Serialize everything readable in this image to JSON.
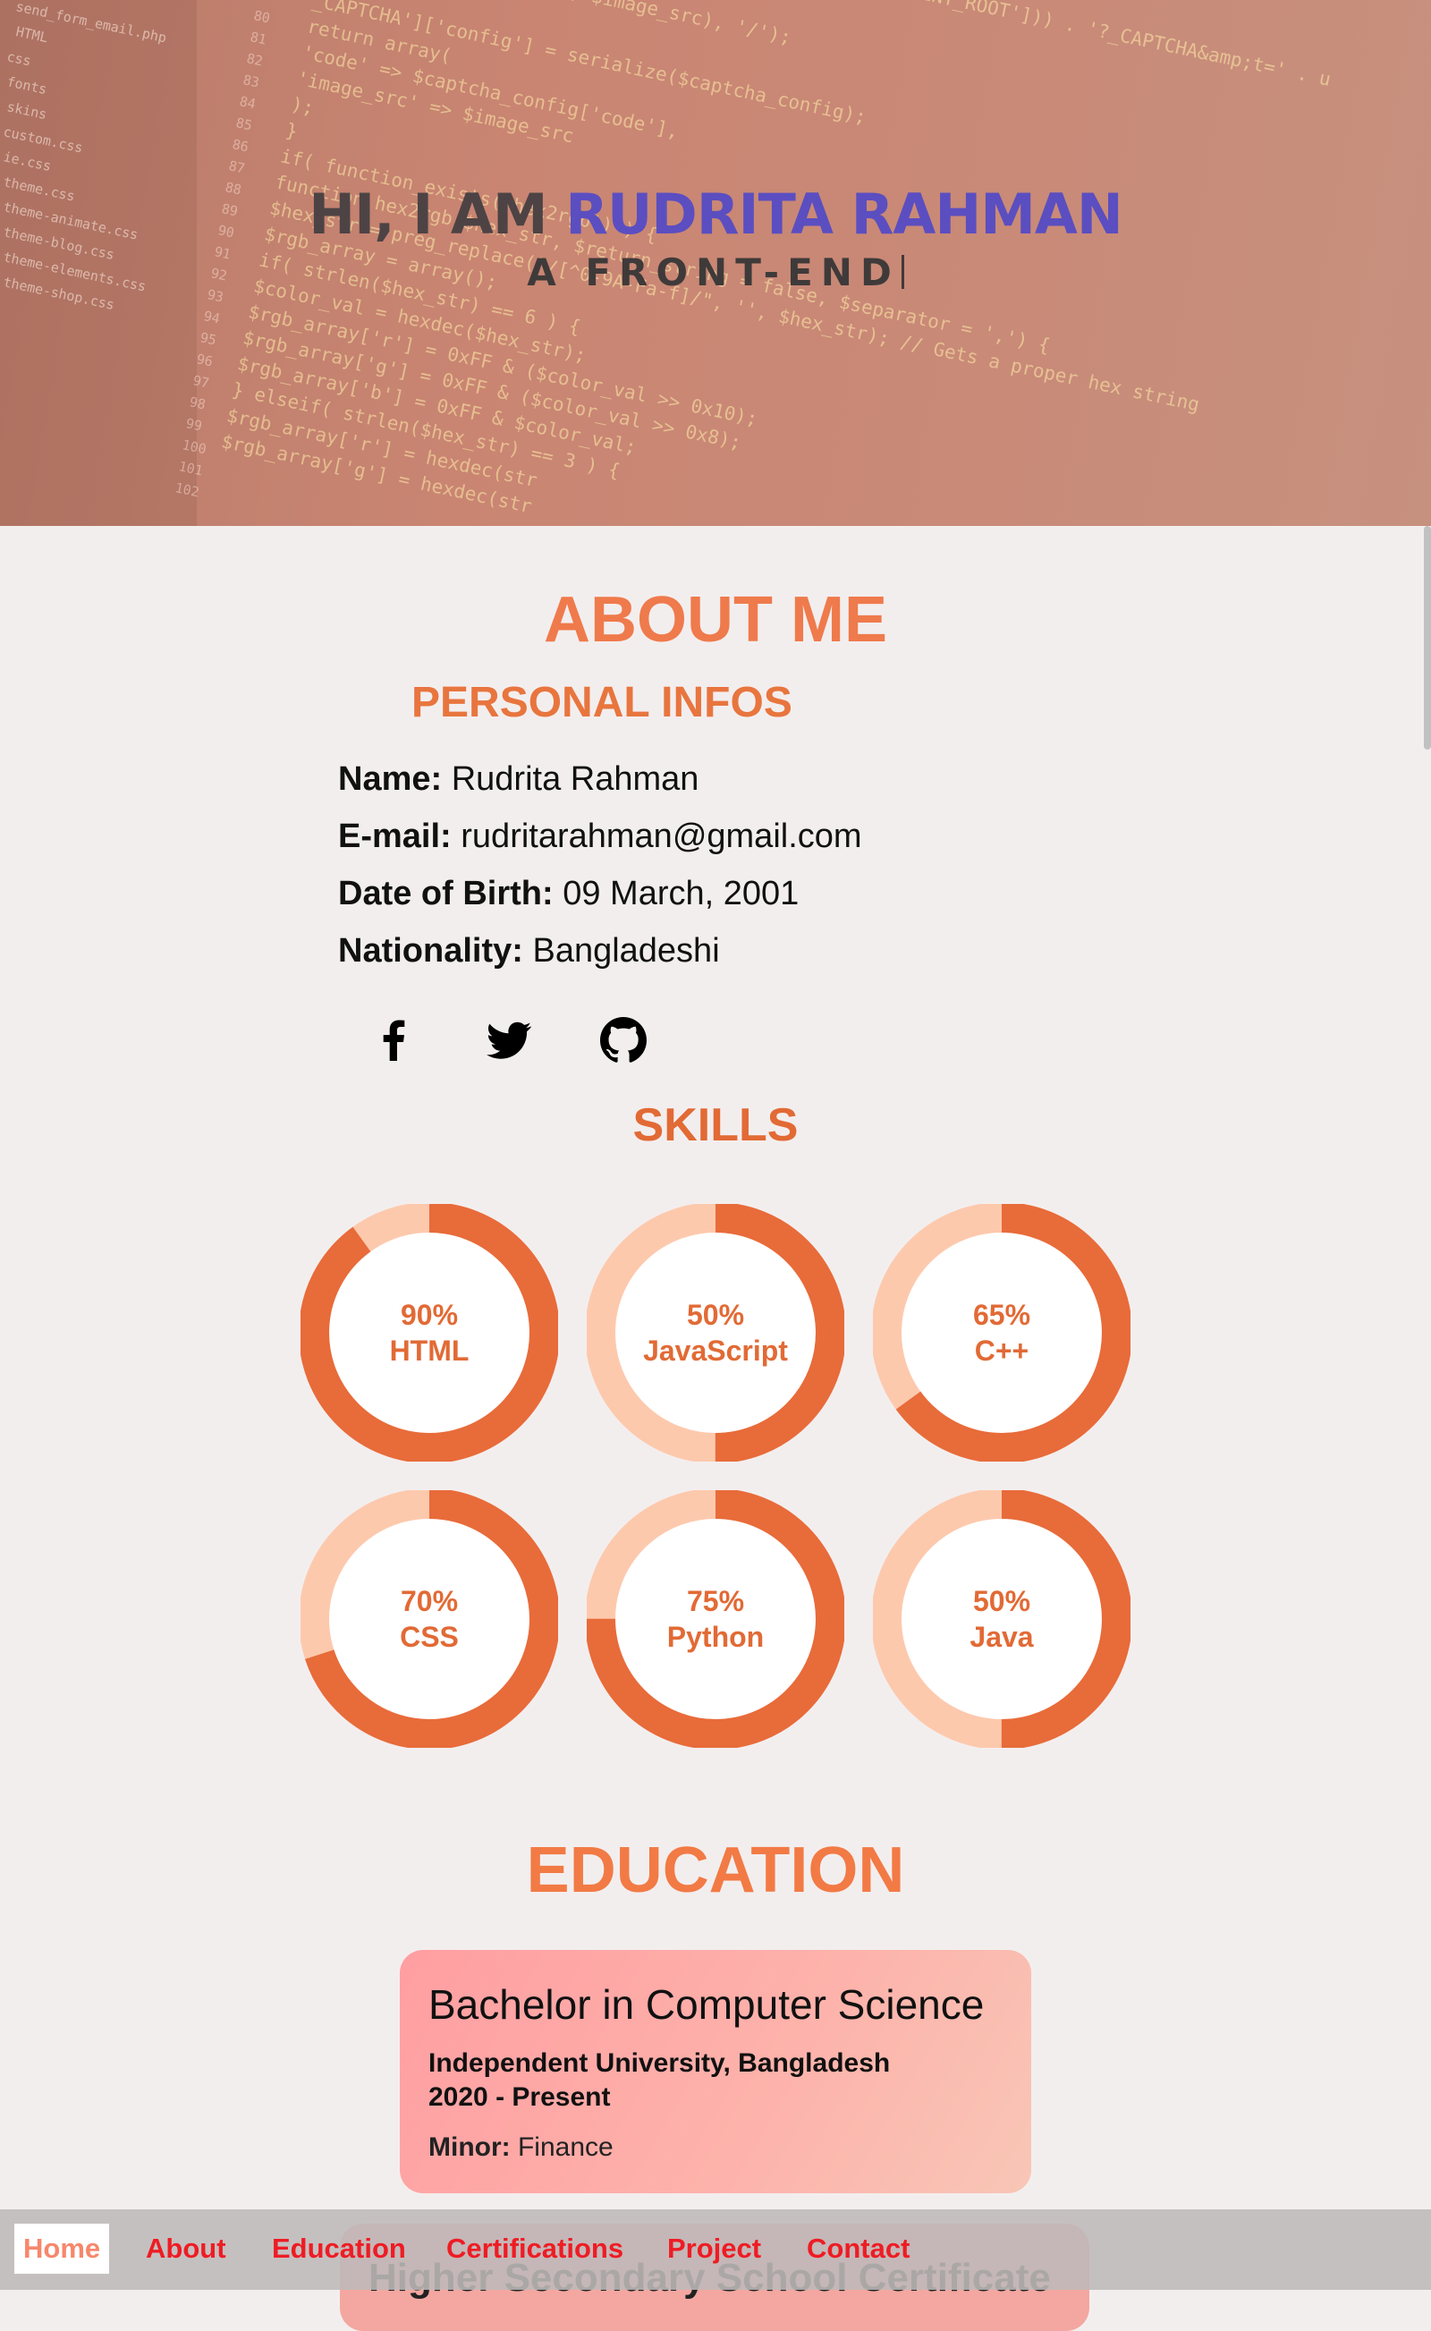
{
  "hero": {
    "greeting": "HI, I AM ",
    "name": "RUDRITA RAHMAN",
    "typed_text": "A FRONT-END",
    "editor_files": [
      "send_form_email.php",
      "HTML",
      "css",
      "fonts",
      "skins",
      "custom.css",
      "ie.css",
      "theme.css",
      "theme-animate.css",
      "theme-blog.css",
      "theme-elements.css",
      "theme-shop.css"
    ],
    "editor_lines": [
      "80",
      "81",
      "82",
      "83",
      "84",
      "85",
      "86",
      "87",
      "88",
      "89",
      "90",
      "91",
      "92",
      "93",
      "94",
      "95",
      "96",
      "97",
      "98",
      "99",
      "100",
      "101",
      "102"
    ],
    "code": [
      "_CAPTCHA']['config'] = serialize($captcha_config);",
      "return array(",
      "  'code' => $captcha_config['code'],",
      "  'image_src' => $image_src",
      ");",
      "}",
      "if( function_exists('hex2rgb') ) {",
      "  function hex2rgb($hex_str, $return_string = false, $separator = ',') {",
      "    $hex_str = preg_replace(\"/[^0-9A-Fa-f]/\", '', $hex_str); // Gets a proper hex string",
      "    $rgb_array = array();",
      "    if( strlen($hex_str) == 6 ) {",
      "      $color_val = hexdec($hex_str);",
      "      $rgb_array['r'] = 0xFF & ($color_val >> 0x10);",
      "      $rgb_array['g'] = 0xFF & ($color_val >> 0x8);",
      "      $rgb_array['b'] = 0xFF & $color_val;",
      "    } elseif( strlen($hex_str) == 3 ) {",
      "      $rgb_array['r'] = hexdec(str",
      "      $rgb_array['g'] = hexdec(str"
    ],
    "code_top_right": "ENT_ROOT'])) . '?_CAPTCHA&amp;t=' . u",
    "code_top_mid": "'/', $image_src), '/');"
  },
  "about": {
    "title": "ABOUT ME",
    "personal_title": "PERSONAL INFOS",
    "fields": [
      {
        "label": "Name:",
        "value": "Rudrita Rahman"
      },
      {
        "label": "E-mail:",
        "value": "rudritarahman@gmail.com"
      },
      {
        "label": "Date of Birth:",
        "value": "09 March, 2001"
      },
      {
        "label": "Nationality:",
        "value": "Bangladeshi"
      }
    ],
    "social_icons": [
      "facebook-icon",
      "twitter-icon",
      "github-icon"
    ]
  },
  "skills": {
    "title": "SKILLS",
    "items": [
      {
        "percent": "90%",
        "name": "HTML",
        "value": 0.9
      },
      {
        "percent": "50%",
        "name": "JavaScript",
        "value": 0.5
      },
      {
        "percent": "65%",
        "name": "C++",
        "value": 0.65
      },
      {
        "percent": "70%",
        "name": "CSS",
        "value": 0.7
      },
      {
        "percent": "75%",
        "name": "Python",
        "value": 0.75
      },
      {
        "percent": "50%",
        "name": "Java",
        "value": 0.5
      }
    ],
    "colors": {
      "filled": "#e86b3a",
      "track": "#fdc9ad"
    }
  },
  "education": {
    "title": "EDUCATION",
    "cards": [
      {
        "degree": "Bachelor in Computer Science",
        "institution": "Independent University, Bangladesh",
        "years": "2020 - Present",
        "minor_label": "Minor:",
        "minor_value": "Finance"
      },
      {
        "degree": "Higher Secondary School Certificate"
      }
    ]
  },
  "nav": {
    "items": [
      "Home",
      "About",
      "Education",
      "Certifications",
      "Project",
      "Contact"
    ],
    "active": "Home"
  }
}
